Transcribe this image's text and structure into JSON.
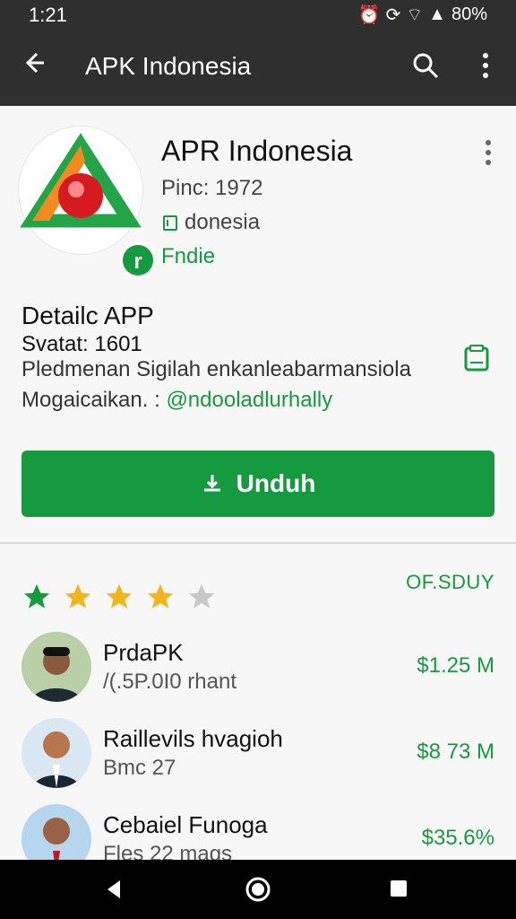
{
  "statusbar": {
    "time": "1:21",
    "battery": "80%"
  },
  "header": {
    "title": "APK Indonesia"
  },
  "app": {
    "name": "APR Indonesia",
    "meta": "Pinc: 1972",
    "country": "donesia",
    "developer": "Fndie"
  },
  "details": {
    "title": "Detailc APP",
    "status": "Svatat: 1601",
    "description": "Pledmenan Sigilah enkanleabarmansiola",
    "contact_label": "Mogaicaikan.",
    "contact_handle": "@ndooladlurhally"
  },
  "download": {
    "label": "Unduh"
  },
  "list": {
    "price_label": "OF.SDUY",
    "rating_value": 4,
    "items": [
      {
        "name": "PrdaPK",
        "sub": "/(.5P.0I0 rhant",
        "amount": "$1.25 M"
      },
      {
        "name": "Raillevils hvagioh",
        "sub": "Bmc 27",
        "amount": "$8 73 M"
      },
      {
        "name": "Cebaiel Funoga",
        "sub": "Fles 22 mags",
        "amount": "$35.6%"
      }
    ]
  },
  "colors": {
    "accent": "#169a3f",
    "bar": "#2f2f2f",
    "star": "#f2b51c"
  }
}
